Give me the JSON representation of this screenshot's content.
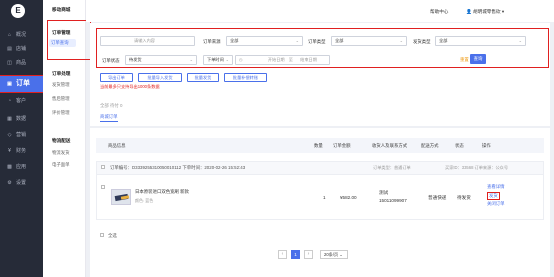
{
  "app": {
    "logo": "E"
  },
  "sidebar": {
    "items": [
      {
        "label": "概况",
        "icon": "home-icon",
        "glyph": "⌂"
      },
      {
        "label": "店铺",
        "icon": "store-icon",
        "glyph": "▤"
      },
      {
        "label": "商品",
        "icon": "goods-icon",
        "glyph": "◫"
      },
      {
        "label": "订单",
        "icon": "order-icon",
        "glyph": "▣"
      },
      {
        "label": "客户",
        "icon": "user-icon",
        "glyph": "◔"
      },
      {
        "label": "数据",
        "icon": "chart-icon",
        "glyph": "▦"
      },
      {
        "label": "营销",
        "icon": "marketing-icon",
        "glyph": "◇"
      },
      {
        "label": "财务",
        "icon": "finance-icon",
        "glyph": "¥"
      },
      {
        "label": "应用",
        "icon": "apps-icon",
        "glyph": "▩"
      },
      {
        "label": "设置",
        "icon": "gear-icon",
        "glyph": "⚙"
      }
    ]
  },
  "subnav": {
    "store_title": "移动商城",
    "group1_title": "订单管理",
    "group1_active": "订单查询",
    "group2_title": "订单处理",
    "group2_items": [
      "发货管理",
      "售后管理",
      "评价管理"
    ],
    "group3_title": "物流配送",
    "group3_items": [
      "物流发货",
      "电子面单"
    ]
  },
  "topbar": {
    "help": "帮助中心",
    "user": "胡明城零售砍",
    "user_icon": "user-icon"
  },
  "filters": {
    "order_no_label": "订单编号",
    "order_no_placeholder": "请输入内容",
    "source_label": "订单来源",
    "source_value": "全部",
    "type_label": "订单类型",
    "type_value": "全部",
    "ship_label": "发货类型",
    "ship_value": "全部",
    "status_label": "订单状态",
    "status_value": "待发货",
    "time_label": "下单时间",
    "start_placeholder": "开始日期",
    "date_sep": "至",
    "end_placeholder": "结束日期",
    "reset": "重置",
    "query": "查询"
  },
  "actions": {
    "export": "导出订单",
    "batch_ship": "批量导入发货",
    "bulk_ship": "批量发货",
    "batch_settle": "批量补偿转账",
    "note": "当前最多只支持导出1000条数据"
  },
  "tabs": {
    "category": "全部  待付  0",
    "active": "商城订单"
  },
  "table": {
    "headers": [
      "商品信息",
      "数量",
      "订单金额",
      "收货人及联系方式",
      "配送方式",
      "状态",
      "操作"
    ],
    "order_line": "订单编号：D3339255310050010112  下单时间：2020-02-26 15:52:43",
    "order_meta": "订单类型：普通订单",
    "order_source": "买家ID：33568  订单来源：公众号",
    "product_name": "日本原装进口双色宽刷 新款",
    "product_spec": "颜色: 蓝色",
    "qty": "1",
    "amount": "¥582.00",
    "receiver_name": "测试",
    "receiver_phone": "15011099907",
    "shipping": "普通快递",
    "status": "待发货",
    "ops": [
      "查看详情",
      "发货",
      "关闭订单"
    ]
  },
  "footer": {
    "select_all": "全选",
    "page": "1",
    "page_size": "20条/页"
  }
}
